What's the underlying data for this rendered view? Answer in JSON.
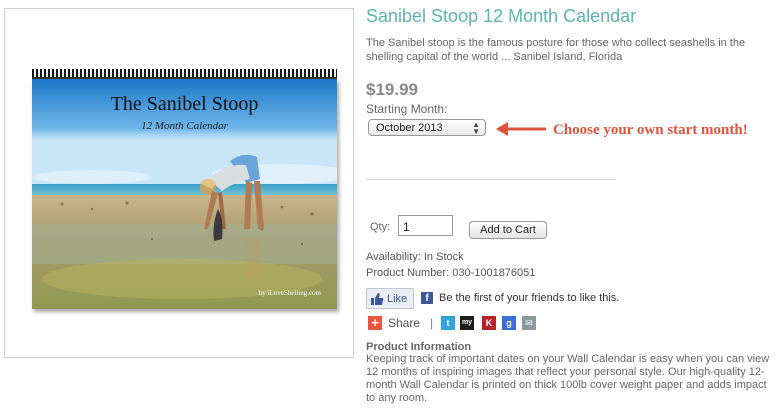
{
  "product": {
    "title": "Sanibel Stoop 12 Month Calendar",
    "description": "The Sanibel stoop is the famous posture for those who collect seashells in the shelling capital of the world ... Sanibel Island, Florida",
    "price": "$19.99",
    "starting_month_label": "Starting Month:",
    "starting_month_value": "October 2013",
    "annotation": "Choose your own start month!",
    "qty_label": "Qty:",
    "qty_value": "1",
    "add_to_cart_label": "Add to Cart",
    "availability": "Availability:  In Stock",
    "product_number": "Product Number:  030-1001876051"
  },
  "image": {
    "calendar_title": "The Sanibel Stoop",
    "calendar_subtitle": "12 Month Calendar",
    "credit": "by iLoveShelling.com"
  },
  "social": {
    "like_label": "Like",
    "fb_text": "Be the first of your friends to like this.",
    "share_label": "Share",
    "separator": "|",
    "icons": [
      "twitter-icon",
      "myspace-icon",
      "kaboodle-icon",
      "google-icon",
      "email-icon"
    ],
    "icon_glyphs": {
      "twitter": "t",
      "myspace": "my",
      "kaboodle": "K",
      "google": "g",
      "email": "✉"
    }
  },
  "info": {
    "heading": "Product Information",
    "body": "Keeping track of important dates on your Wall Calendar is easy when you can view 12 months of inspiring images that reflect your personal style. Our high-quality 12-month Wall Calendar is printed on thick 100lb cover weight paper and adds impact to any room."
  },
  "colors": {
    "title": "#5bb5b0",
    "annotation": "#e0533c",
    "facebook": "#3b5998"
  }
}
